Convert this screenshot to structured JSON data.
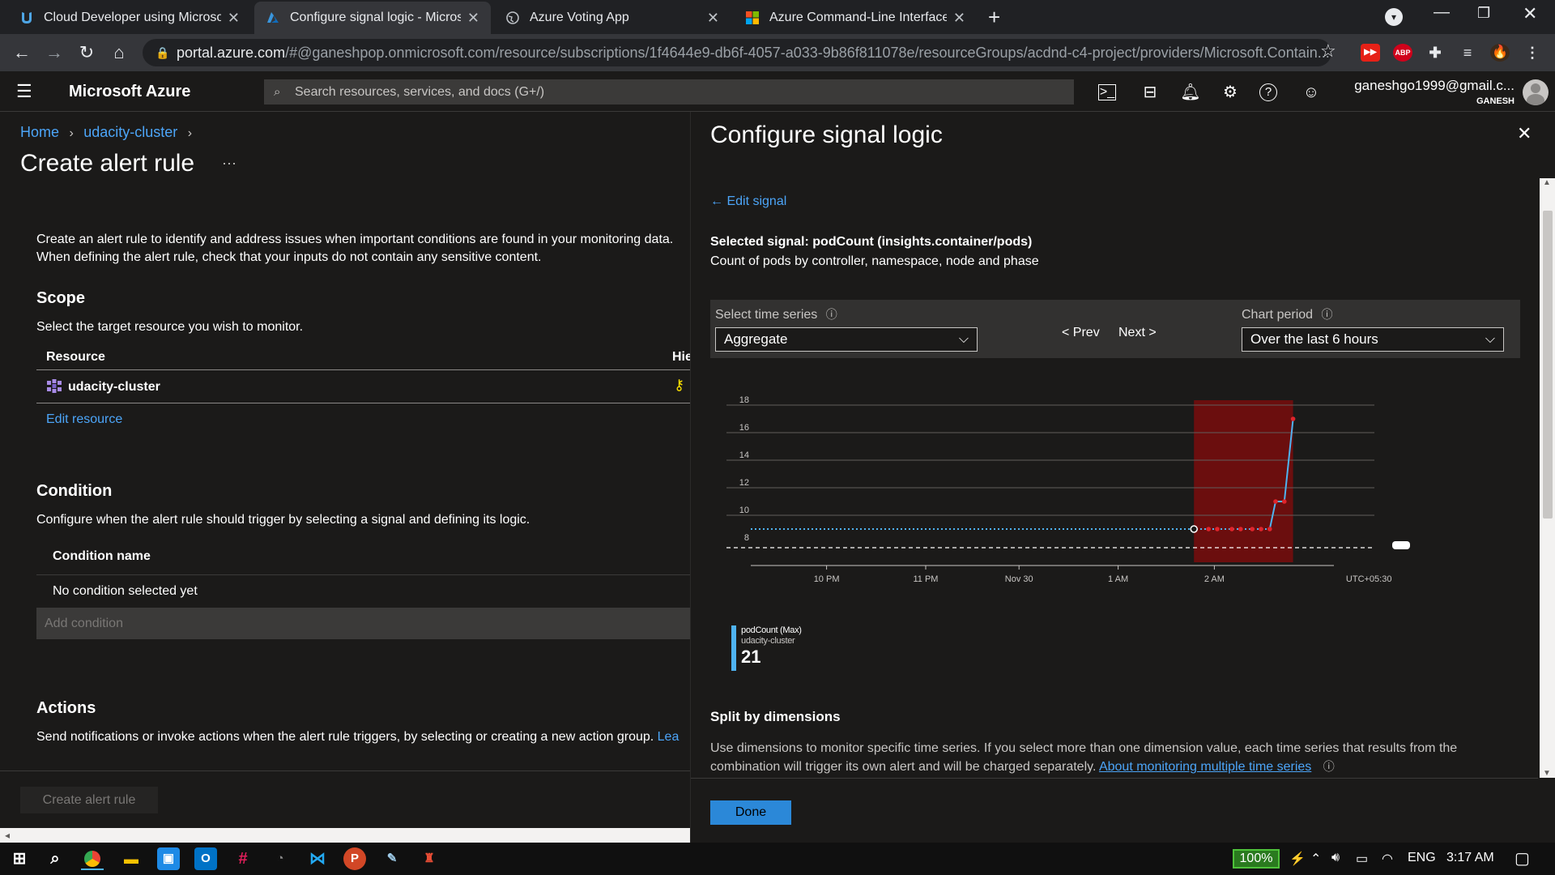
{
  "browser": {
    "tabs": [
      {
        "title": "Cloud Developer using Microsoft"
      },
      {
        "title": "Configure signal logic - Microsoft"
      },
      {
        "title": "Azure Voting App"
      },
      {
        "title": "Azure Command-Line Interface (C"
      }
    ],
    "url_host": "portal.azure.com",
    "url_rest": "/#@ganeshpop.onmicrosoft.com/resource/subscriptions/1f4644e9-db6f-4057-a033-9b86f811078e/resourceGroups/acdnd-c4-project/providers/Microsoft.Contain...",
    "ext_abp": "ABP"
  },
  "azure": {
    "brand": "Microsoft Azure",
    "search_placeholder": "Search resources, services, and docs (G+/)",
    "account_email": "ganeshgo1999@gmail.c...",
    "account_name": "GANESH"
  },
  "blade": {
    "breadcrumb": [
      "Home",
      "udacity-cluster"
    ],
    "title": "Create alert rule",
    "more": "···",
    "intro_line1": "Create an alert rule to identify and address issues when important conditions are found in your monitoring data.",
    "intro_line2": "When defining the alert rule, check that your inputs do not contain any sensitive content.",
    "scope_heading": "Scope",
    "scope_desc": "Select the target resource you wish to monitor.",
    "resource_col": "Resource",
    "hier_col": "Hiе",
    "resource_name": "udacity-cluster",
    "edit_resource": "Edit resource",
    "condition_heading": "Condition",
    "condition_desc": "Configure when the alert rule should trigger by selecting a signal and defining its logic.",
    "condition_col": "Condition name",
    "condition_empty": "No condition selected yet",
    "add_condition": "Add condition",
    "actions_heading": "Actions",
    "actions_desc": "Send notifications or invoke actions when the alert rule triggers, by selecting or creating a new action group.",
    "actions_link": "Lea",
    "create_button": "Create alert rule"
  },
  "panel": {
    "title": "Configure signal logic",
    "edit_signal": "Edit signal",
    "selected_signal": "Selected signal: podCount (insights.container/pods)",
    "signal_desc": "Count of pods by controller, namespace, node and phase",
    "time_series_label": "Select time series",
    "time_series_value": "Aggregate",
    "prev": "< Prev",
    "next": "Next >",
    "chart_period_label": "Chart period",
    "chart_period_value": "Over the last 6 hours",
    "legend_metric": "podCount (Max)",
    "legend_resource": "udacity-cluster",
    "legend_value": "21",
    "split_heading": "Split by dimensions",
    "split_desc1": "Use dimensions to monitor specific time series. If you select more than one dimension value, each time series that results from the",
    "split_desc2": "combination will trigger its own alert and will be charged separately.",
    "split_link": "About monitoring multiple time series",
    "done": "Done"
  },
  "chart_data": {
    "type": "line",
    "y_ticks": [
      "18",
      "16",
      "14",
      "12",
      "10",
      "8"
    ],
    "ylim": [
      8,
      18
    ],
    "x_ticks": [
      "10 PM",
      "11 PM",
      "Nov 30",
      "1 AM",
      "2 AM",
      "UTC+05:30"
    ],
    "series": [
      {
        "name": "podCount (Max)",
        "x": [
          0.0,
          0.76,
          0.785,
          0.8,
          0.825,
          0.84,
          0.86,
          0.875,
          0.89,
          0.9,
          0.915,
          0.93
        ],
        "values": [
          9.0,
          9.0,
          9.0,
          9.0,
          9.0,
          9.0,
          9.0,
          9.0,
          9.0,
          11.0,
          11.0,
          17.0
        ]
      }
    ],
    "threshold": 8,
    "highlight_range": [
      0.76,
      0.93
    ],
    "highlight_color": "#6b0e0e",
    "line_color": "#4fb3f0",
    "point_color": "#e0242b"
  },
  "taskbar": {
    "battery": "100%",
    "lang": "ENG",
    "time": "3:17 AM"
  }
}
